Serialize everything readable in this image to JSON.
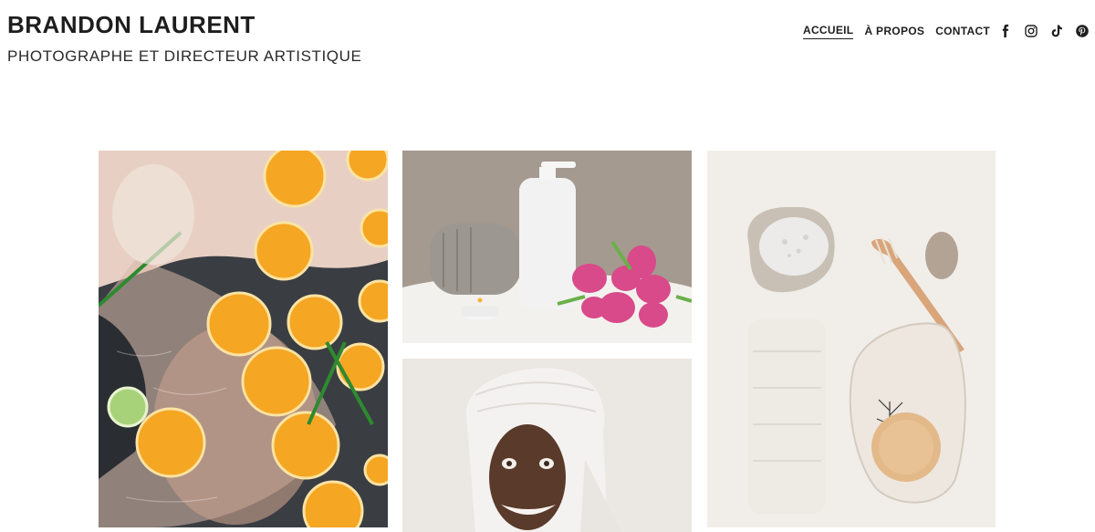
{
  "header": {
    "title": "BRANDON LAURENT",
    "subtitle": "PHOTOGRAPHE ET DIRECTEUR ARTISTIQUE"
  },
  "nav": {
    "items": [
      {
        "label": "ACCUEIL",
        "active": true
      },
      {
        "label": "À PROPOS",
        "active": false
      },
      {
        "label": "CONTACT",
        "active": false
      }
    ]
  },
  "socials": [
    "facebook-icon",
    "instagram-icon",
    "tiktok-icon",
    "pinterest-icon"
  ],
  "gallery": [
    {
      "name": "photo-citrus-bath"
    },
    {
      "name": "photo-spa-towel-bottle"
    },
    {
      "name": "photo-face-mask"
    },
    {
      "name": "photo-spa-flatlay"
    }
  ],
  "colors": {
    "text": "#1e1e1e",
    "background": "#ffffff"
  }
}
